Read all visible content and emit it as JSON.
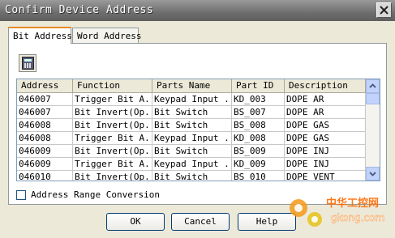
{
  "window": {
    "title": "Confirm Device Address"
  },
  "tabs": [
    {
      "label": "Bit Address"
    },
    {
      "label": "Word Address"
    }
  ],
  "toolbar": {
    "calculator_icon": "calculator-icon"
  },
  "table": {
    "columns": [
      "Address",
      "Function",
      "Parts Name",
      "Part ID",
      "Description"
    ],
    "rows": [
      [
        "046007",
        "Trigger Bit A...",
        "Keypad Input ...",
        "KD_003",
        "DOPE AR"
      ],
      [
        "046007",
        "Bit Invert(Op...",
        "Bit Switch",
        "BS_007",
        "DOPE AR"
      ],
      [
        "046008",
        "Bit Invert(Op...",
        "Bit Switch",
        "BS_008",
        "DOPE GAS"
      ],
      [
        "046008",
        "Trigger Bit A...",
        "Keypad Input ...",
        "KD_008",
        "DOPE GAS"
      ],
      [
        "046009",
        "Bit Invert(Op...",
        "Bit Switch",
        "BS_009",
        "DOPE INJ"
      ],
      [
        "046009",
        "Trigger Bit A...",
        "Keypad Input ...",
        "KD_009",
        "DOPE INJ"
      ],
      [
        "046010",
        "Bit Invert(Op...",
        "Bit Switch",
        "BS_010",
        "DOPE VENT"
      ]
    ]
  },
  "options": {
    "address_range_label": "Address Range Conversion",
    "address_range_checked": false
  },
  "buttons": {
    "ok": "OK",
    "cancel": "Cancel",
    "help": "Help"
  },
  "watermark": {
    "text_cn": "中华工控网",
    "text_url": "gkong.com"
  }
}
